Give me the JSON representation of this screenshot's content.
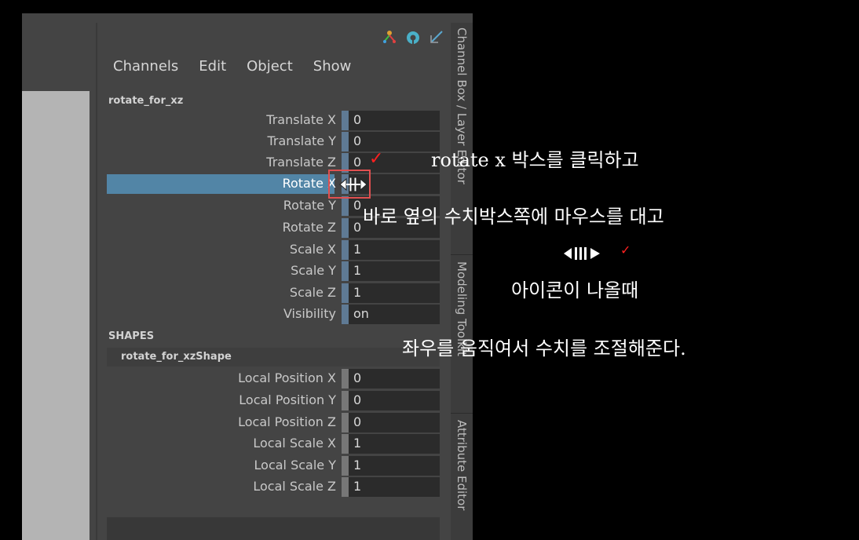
{
  "menu": [
    "Channels",
    "Edit",
    "Object",
    "Show"
  ],
  "object_name": "rotate_for_xz",
  "channels": [
    {
      "label": "Translate X",
      "value": "0"
    },
    {
      "label": "Translate Y",
      "value": "0"
    },
    {
      "label": "Translate Z",
      "value": "0"
    },
    {
      "label": "Rotate X",
      "value": ""
    },
    {
      "label": "Rotate Y",
      "value": "0"
    },
    {
      "label": "Rotate Z",
      "value": "0"
    },
    {
      "label": "Scale X",
      "value": "1"
    },
    {
      "label": "Scale Y",
      "value": "1"
    },
    {
      "label": "Scale Z",
      "value": "1"
    },
    {
      "label": "Visibility",
      "value": "on"
    }
  ],
  "shapes_header": "SHAPES",
  "shape_name": "rotate_for_xzShape",
  "shape_channels": [
    {
      "label": "Local Position X",
      "value": "0"
    },
    {
      "label": "Local Position Y",
      "value": "0"
    },
    {
      "label": "Local Position Z",
      "value": "0"
    },
    {
      "label": "Local Scale X",
      "value": "1"
    },
    {
      "label": "Local Scale Y",
      "value": "1"
    },
    {
      "label": "Local Scale Z",
      "value": "1"
    }
  ],
  "side_tabs": [
    "Channel Box / Layer Editor",
    "Modeling Toolkit",
    "Attribute Editor"
  ],
  "annotations": {
    "line1": "rotate x 박스를 클릭하고",
    "line2": "바로 옆의 수치박스쪽에 마우스를 대고",
    "line3": "아이콘이 나올때",
    "line4": "좌우를 움직여서 수치를 조절해준다."
  },
  "colors": {
    "highlight_row": "#5285a6",
    "annotation_mark": "#ff2020"
  },
  "icons": [
    "axis-icon",
    "refresh-icon",
    "pen-icon",
    "slide-cursor-icon",
    "checkmark-icon"
  ]
}
